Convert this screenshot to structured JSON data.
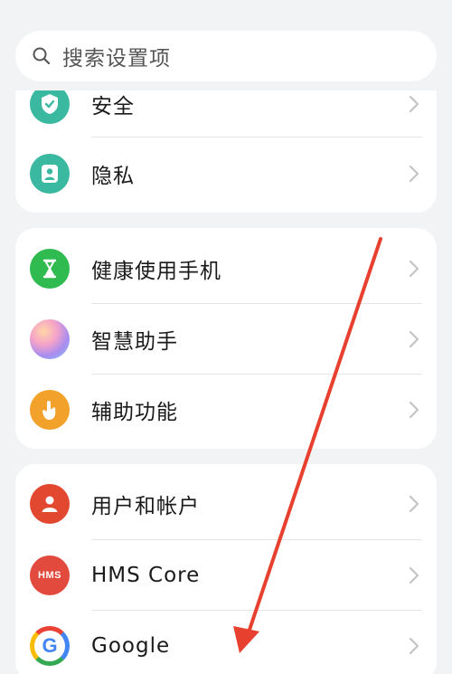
{
  "search": {
    "placeholder": "搜索设置项"
  },
  "groups": [
    {
      "items": [
        {
          "label": "安全",
          "icon": "shield-icon",
          "color": "#3bb8a0"
        },
        {
          "label": "隐私",
          "icon": "privacy-icon",
          "color": "#3bb8a0"
        }
      ]
    },
    {
      "items": [
        {
          "label": "健康使用手机",
          "icon": "hourglass-icon",
          "color": "#2fbb4f"
        },
        {
          "label": "智慧助手",
          "icon": "assistant-icon",
          "color": "#c9a3ee"
        },
        {
          "label": "辅助功能",
          "icon": "accessibility-hand-icon",
          "color": "#f2a12a"
        }
      ]
    },
    {
      "items": [
        {
          "label": "用户和帐户",
          "icon": "user-icon",
          "color": "#e2472f"
        },
        {
          "label": "HMS Core",
          "icon": "hms-icon",
          "color": "#e14a3d",
          "icon_text": "HMS"
        },
        {
          "label": "Google",
          "icon": "google-icon",
          "color": "#ffffff",
          "icon_text": "G"
        }
      ]
    }
  ],
  "annotation_color": "#e8402e"
}
